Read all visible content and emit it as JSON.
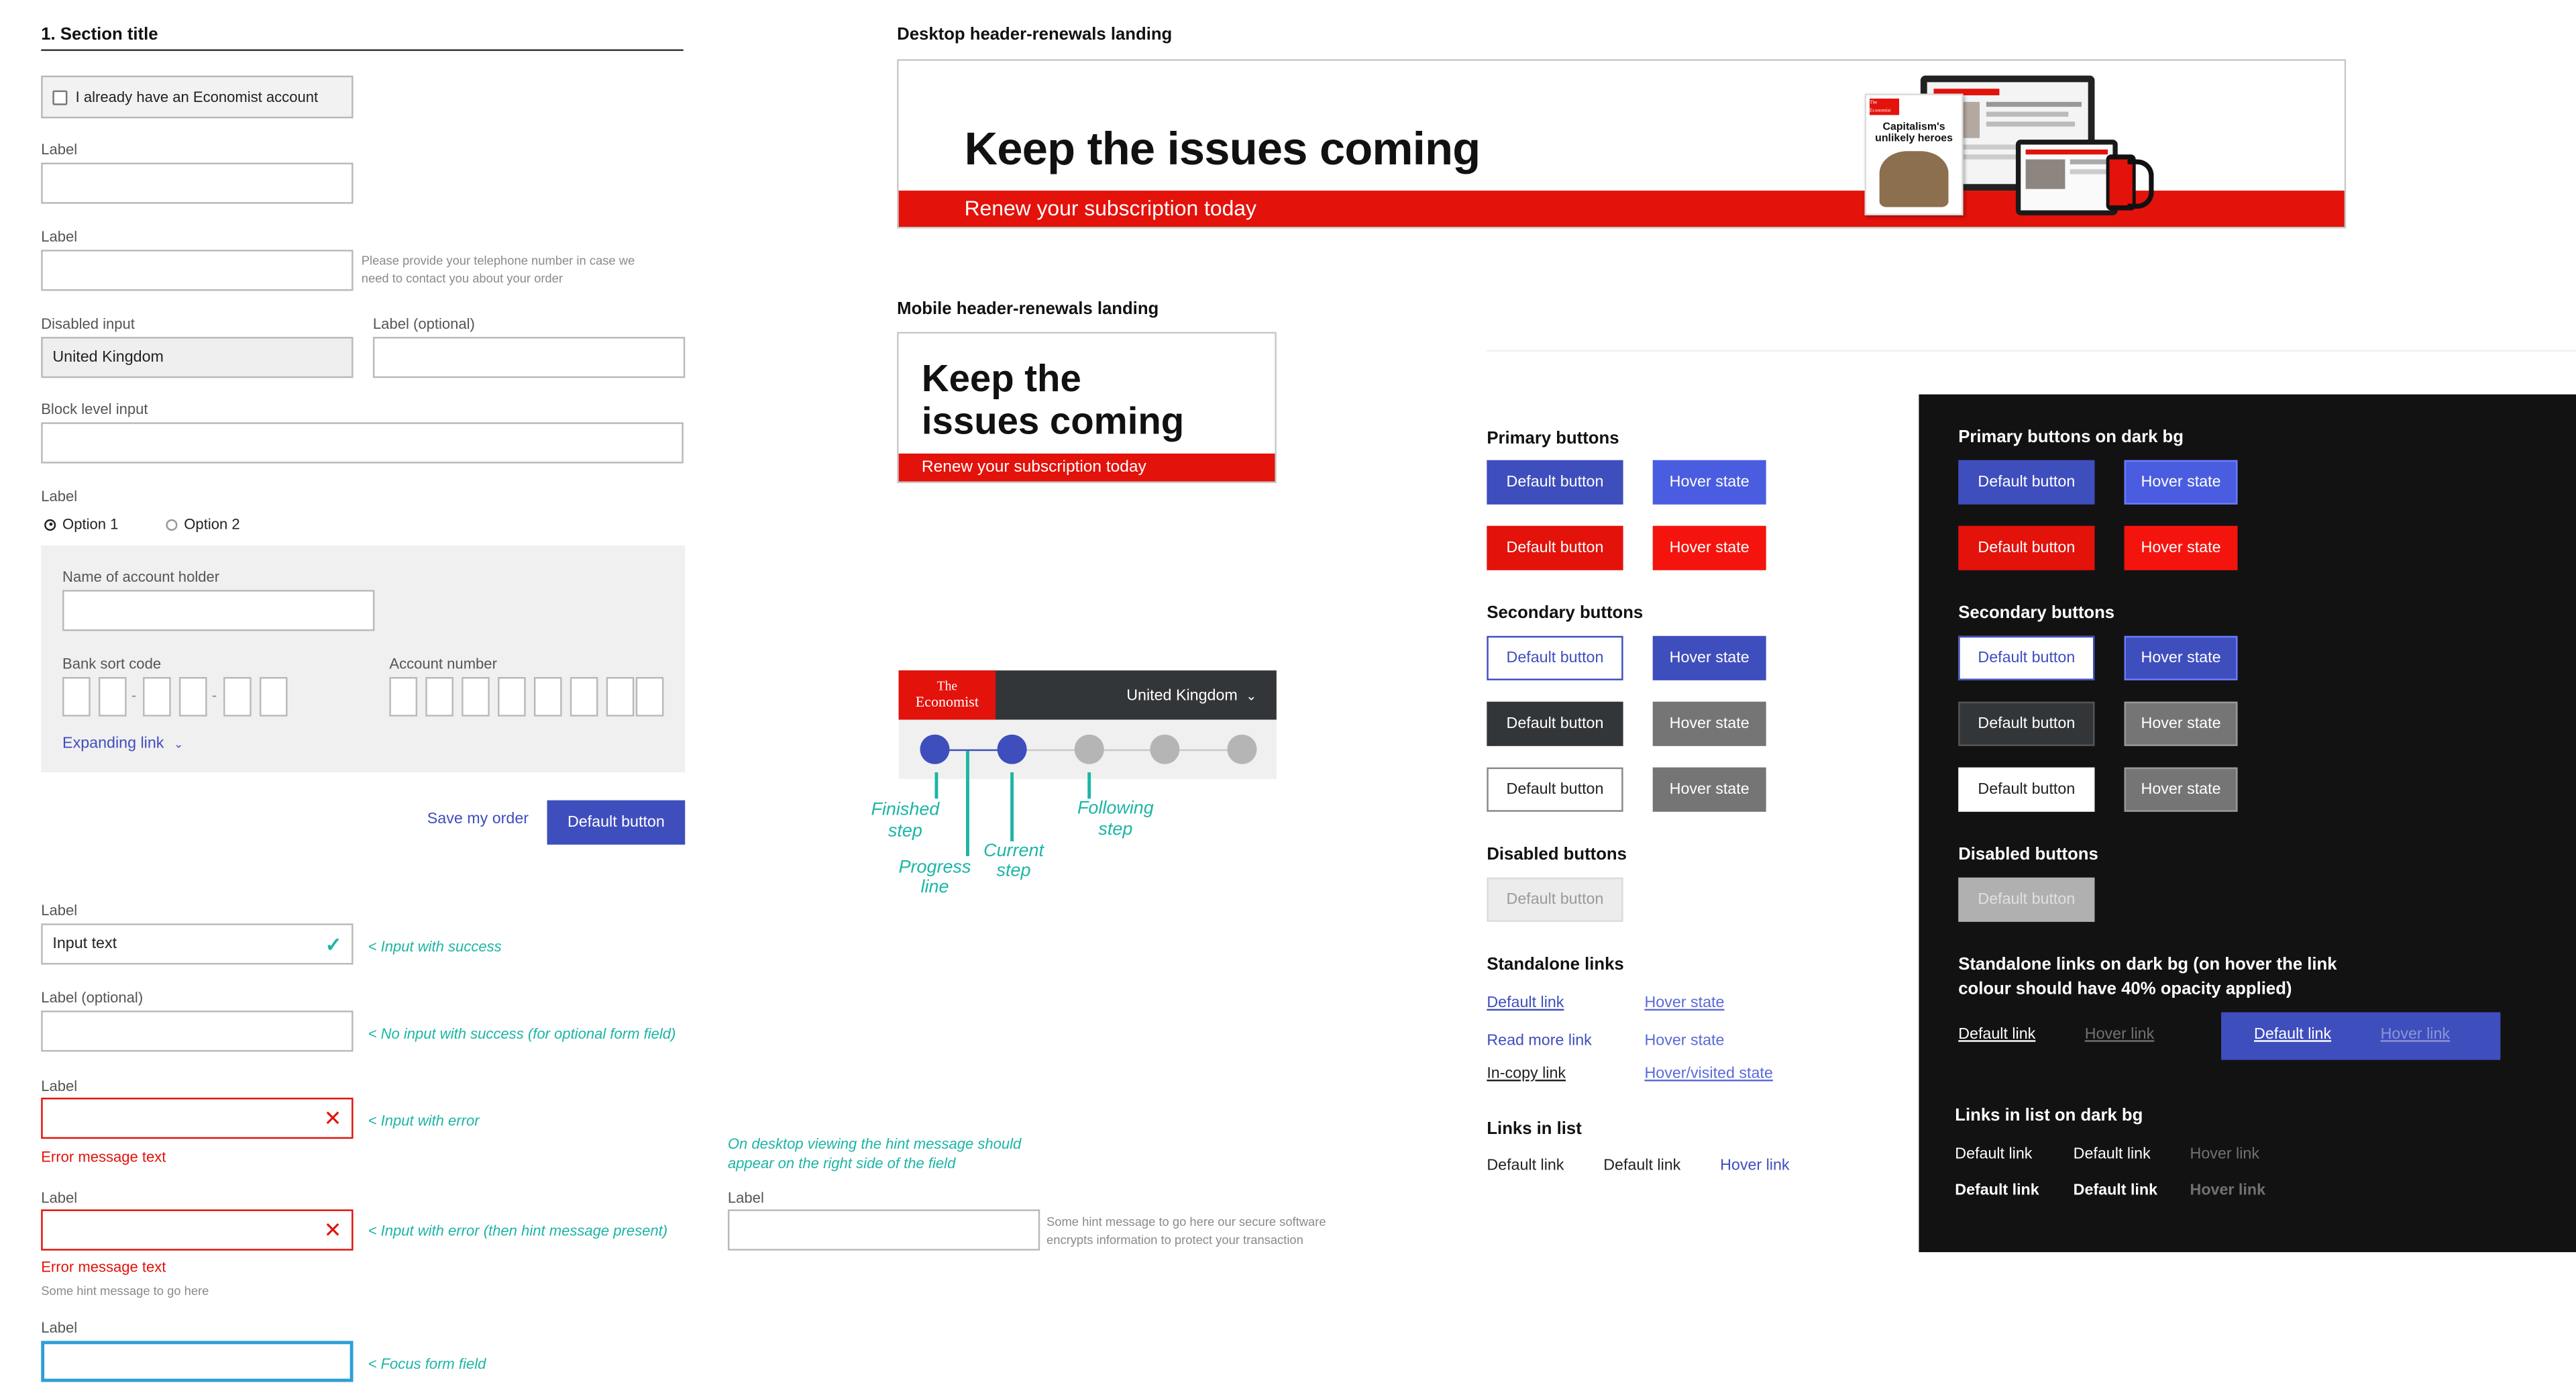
{
  "form": {
    "section_title": "1. Section title",
    "checkbox_label": "I already have an Economist account",
    "label1": "Label",
    "label2": "Label",
    "phone_hint": "Please provide your telephone number in case we need to contact you about your order",
    "disabled_label": "Disabled input",
    "disabled_value": "United Kingdom",
    "optional_label": "Label (optional)",
    "block_label": "Block level input",
    "radio_label": "Label",
    "option1": "Option 1",
    "option2": "Option 2",
    "account_holder_label": "Name of account holder",
    "sort_code_label": "Bank sort code",
    "account_number_label": "Account number",
    "sort_dash": "-",
    "expanding_link": "Expanding link",
    "save_link": "Save my order",
    "default_button": "Default button"
  },
  "validation": {
    "success_label": "Label",
    "success_value": "Input text",
    "success_note": "< Input with success",
    "optional_label": "Label (optional)",
    "optional_note": "< No input with success (for optional form field)",
    "error_label": "Label",
    "error_note": "< Input with error",
    "error_message": "Error message text",
    "error2_label": "Label",
    "error2_note": "< Input with error (then hint message present)",
    "error2_message": "Error message text",
    "error2_hint": "Some hint message to go here",
    "focus_label": "Label",
    "focus_note": "< Focus form field"
  },
  "hint_demo": {
    "note": "On desktop viewing the hint message should appear on the right side of the field",
    "label": "Label",
    "hint": "Some hint message to go here our secure software encrypts information to protect your transaction"
  },
  "desktop_header": {
    "title": "Desktop header-renewals landing",
    "headline": "Keep the issues coming",
    "subline": "Renew your subscription today",
    "cover_brand": "The Economist",
    "cover_headline": "Capitalism's unlikely heroes"
  },
  "mobile_header": {
    "title": "Mobile header-renewals landing",
    "headline_l1": "Keep the",
    "headline_l2": "issues coming",
    "subline": "Renew your subscription today"
  },
  "stepper": {
    "logo_l1": "The",
    "logo_l2": "Economist",
    "country": "United Kingdom",
    "finished": "Finished step",
    "progress": "Progress line",
    "current": "Current step",
    "following": "Following step"
  },
  "light_buttons": {
    "primary_title": "Primary buttons",
    "default": "Default button",
    "hover": "Hover state",
    "secondary_title": "Secondary buttons",
    "disabled_title": "Disabled buttons",
    "disabled": "Default button",
    "links_title": "Standalone links",
    "default_link": "Default link",
    "hover_state": "Hover state",
    "read_more": "Read more link",
    "in_copy": "In-copy link",
    "hover_visited": "Hover/visited state",
    "list_title": "Links in list",
    "list_default": "Default link",
    "list_hover": "Hover link"
  },
  "dark_buttons": {
    "primary_title": "Primary buttons on dark bg",
    "default": "Default button",
    "hover": "Hover state",
    "secondary_title": "Secondary buttons",
    "disabled_title": "Disabled buttons",
    "disabled": "Default button",
    "links_title_l1": "Standalone links on dark bg (on hover the link",
    "links_title_l2": "colour should have 40% opacity applied)",
    "default_link": "Default link",
    "hover_link": "Hover link",
    "list_title": "Links in list on dark bg"
  },
  "colors": {
    "primary_blue": "#3f4ebd",
    "hover_blue": "#4a5de0",
    "economist_red": "#e3120b",
    "hover_red": "#f5140d",
    "dark_bg": "#121212",
    "annotation": "#1cb5a5"
  }
}
